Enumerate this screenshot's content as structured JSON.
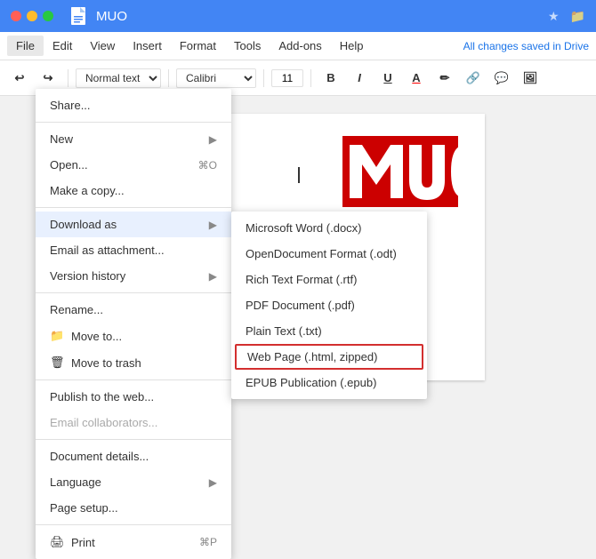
{
  "titleBar": {
    "title": "MUO",
    "starLabel": "★",
    "folderLabel": "📁"
  },
  "menuBar": {
    "items": [
      "File",
      "Edit",
      "View",
      "Insert",
      "Format",
      "Tools",
      "Add-ons",
      "Help"
    ],
    "activeItem": "File",
    "savedStatus": "All changes saved in Drive"
  },
  "toolbar": {
    "normalText": "Normal text",
    "font": "Calibri",
    "fontSize": "11",
    "boldLabel": "B",
    "italicLabel": "I",
    "underlineLabel": "U"
  },
  "fileMenu": {
    "items": [
      {
        "id": "share",
        "label": "Share...",
        "shortcut": ""
      },
      {
        "id": "sep1",
        "type": "separator"
      },
      {
        "id": "new",
        "label": "New",
        "arrow": true
      },
      {
        "id": "open",
        "label": "Open...",
        "shortcut": "⌘O"
      },
      {
        "id": "copy",
        "label": "Make a copy..."
      },
      {
        "id": "sep2",
        "type": "separator"
      },
      {
        "id": "download",
        "label": "Download as",
        "arrow": true,
        "highlighted": true
      },
      {
        "id": "email",
        "label": "Email as attachment..."
      },
      {
        "id": "version",
        "label": "Version history",
        "arrow": true
      },
      {
        "id": "sep3",
        "type": "separator"
      },
      {
        "id": "rename",
        "label": "Rename..."
      },
      {
        "id": "moveto",
        "label": "Move to...",
        "icon": "📁"
      },
      {
        "id": "trash",
        "label": "Move to trash",
        "icon": "🗑"
      },
      {
        "id": "sep4",
        "type": "separator"
      },
      {
        "id": "publish",
        "label": "Publish to the web..."
      },
      {
        "id": "email-collab",
        "label": "Email collaborators...",
        "disabled": true
      },
      {
        "id": "sep5",
        "type": "separator"
      },
      {
        "id": "details",
        "label": "Document details..."
      },
      {
        "id": "language",
        "label": "Language",
        "arrow": true
      },
      {
        "id": "pagesetup",
        "label": "Page setup..."
      },
      {
        "id": "sep6",
        "type": "separator"
      },
      {
        "id": "print",
        "label": "Print",
        "icon": "🖨",
        "shortcut": "⌘P"
      }
    ]
  },
  "downloadSubmenu": {
    "items": [
      {
        "id": "docx",
        "label": "Microsoft Word (.docx)"
      },
      {
        "id": "odt",
        "label": "OpenDocument Format (.odt)"
      },
      {
        "id": "rtf",
        "label": "Rich Text Format (.rtf)"
      },
      {
        "id": "pdf",
        "label": "PDF Document (.pdf)"
      },
      {
        "id": "txt",
        "label": "Plain Text (.txt)"
      },
      {
        "id": "html",
        "label": "Web Page (.html, zipped)",
        "highlighted": true
      },
      {
        "id": "epub",
        "label": "EPUB Publication (.epub)"
      }
    ]
  },
  "doc": {
    "cursorVisible": true
  }
}
